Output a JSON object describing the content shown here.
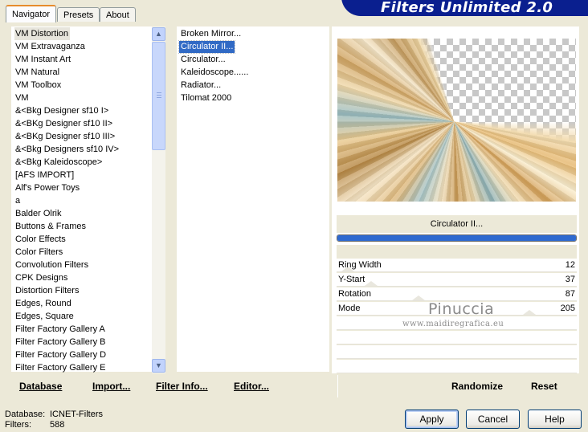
{
  "banner": {
    "title": "Filters Unlimited 2.0"
  },
  "tabs": [
    {
      "label": "Navigator",
      "active": true
    },
    {
      "label": "Presets",
      "active": false
    },
    {
      "label": "About",
      "active": false
    }
  ],
  "categories": [
    "VM Distortion",
    "VM Extravaganza",
    "VM Instant Art",
    "VM Natural",
    "VM Toolbox",
    "VM",
    "&<Bkg Designer sf10 I>",
    "&<BKg Designer sf10 II>",
    "&<BKg Designer sf10 III>",
    "&<Bkg Designers sf10 IV>",
    "&<Bkg Kaleidoscope>",
    "[AFS IMPORT]",
    "Alf's Power Toys",
    "a",
    "Balder Olrik",
    "Buttons & Frames",
    "Color Effects",
    "Color Filters",
    "Convolution Filters",
    "CPK Designs",
    "Distortion Filters",
    "Edges, Round",
    "Edges, Square",
    "Filter Factory Gallery A",
    "Filter Factory Gallery B",
    "Filter Factory Gallery D",
    "Filter Factory Gallery E"
  ],
  "selected_category": "VM Distortion",
  "filters": [
    "Broken Mirror...",
    "Circulator II...",
    "Circulator...",
    "Kaleidoscope......",
    "Radiator...",
    "Tilomat 2000"
  ],
  "selected_filter": "Circulator II...",
  "preview": {
    "filter_name": "Circulator II...",
    "progress": 1.0
  },
  "parameters": [
    {
      "label": "Ring Width",
      "value": 12,
      "fraction": 0.047
    },
    {
      "label": "Y-Start",
      "value": 37,
      "fraction": 0.145
    },
    {
      "label": "Rotation",
      "value": 87,
      "fraction": 0.341
    },
    {
      "label": "Mode",
      "value": 205,
      "fraction": 0.804
    }
  ],
  "watermark": {
    "name": "Pinuccia",
    "url": "www.maidiregrafica.eu"
  },
  "toolbar": {
    "database": "Database",
    "import": "Import...",
    "filter_info": "Filter Info...",
    "editor": "Editor...",
    "randomize": "Randomize",
    "reset": "Reset"
  },
  "status": {
    "database_label": "Database:",
    "database_value": "ICNET-Filters",
    "filters_label": "Filters:",
    "filters_value": "588"
  },
  "buttons": {
    "apply": "Apply",
    "cancel": "Cancel",
    "help": "Help"
  },
  "icons": {
    "scroll_up": "triangle-up",
    "scroll_down": "triangle-down"
  }
}
